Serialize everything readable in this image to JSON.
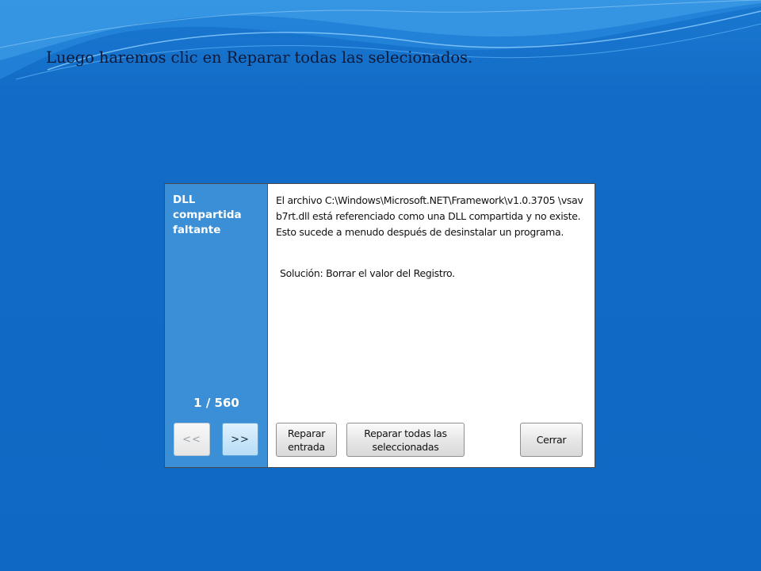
{
  "slide": {
    "caption": "Luego haremos clic en Reparar todas las selecionados."
  },
  "dialog": {
    "side_title": "DLL compartida faltante",
    "counter": "1 / 560",
    "prev_label": "<<",
    "next_label": ">>",
    "message": "El archivo C:\\Windows\\Microsoft.NET\\Framework\\v1.0.3705 \\vsavb7rt.dll está referenciado como una DLL compartida y no existe. Esto sucede a menudo después de desinstalar un programa.",
    "solution": "Solución: Borrar el valor del Registro.",
    "repair_entry_label": "Reparar entrada",
    "repair_all_label": "Reparar todas las seleccionadas",
    "close_label": "Cerrar"
  },
  "colors": {
    "background": "#1169c4",
    "side_panel": "#3a8fd6",
    "caption_text": "#0b1a3a"
  }
}
